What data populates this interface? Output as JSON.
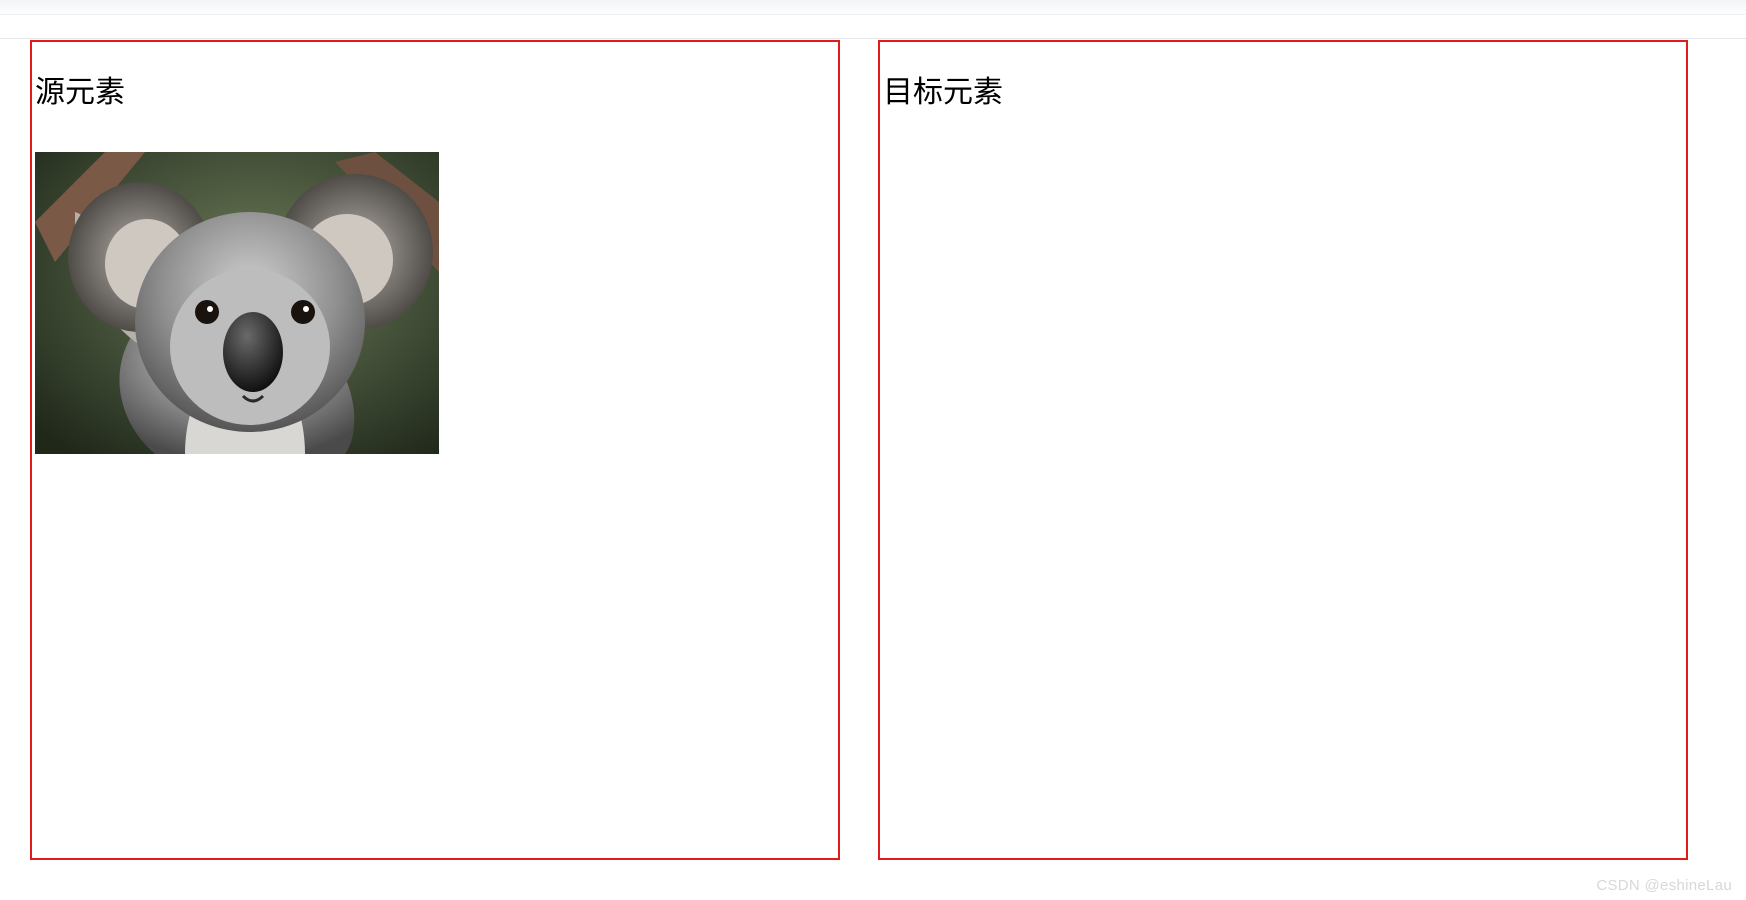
{
  "source_panel": {
    "title": "源元素",
    "image_alt": "koala-image"
  },
  "target_panel": {
    "title": "目标元素"
  },
  "watermark": "CSDN @eshineLau"
}
